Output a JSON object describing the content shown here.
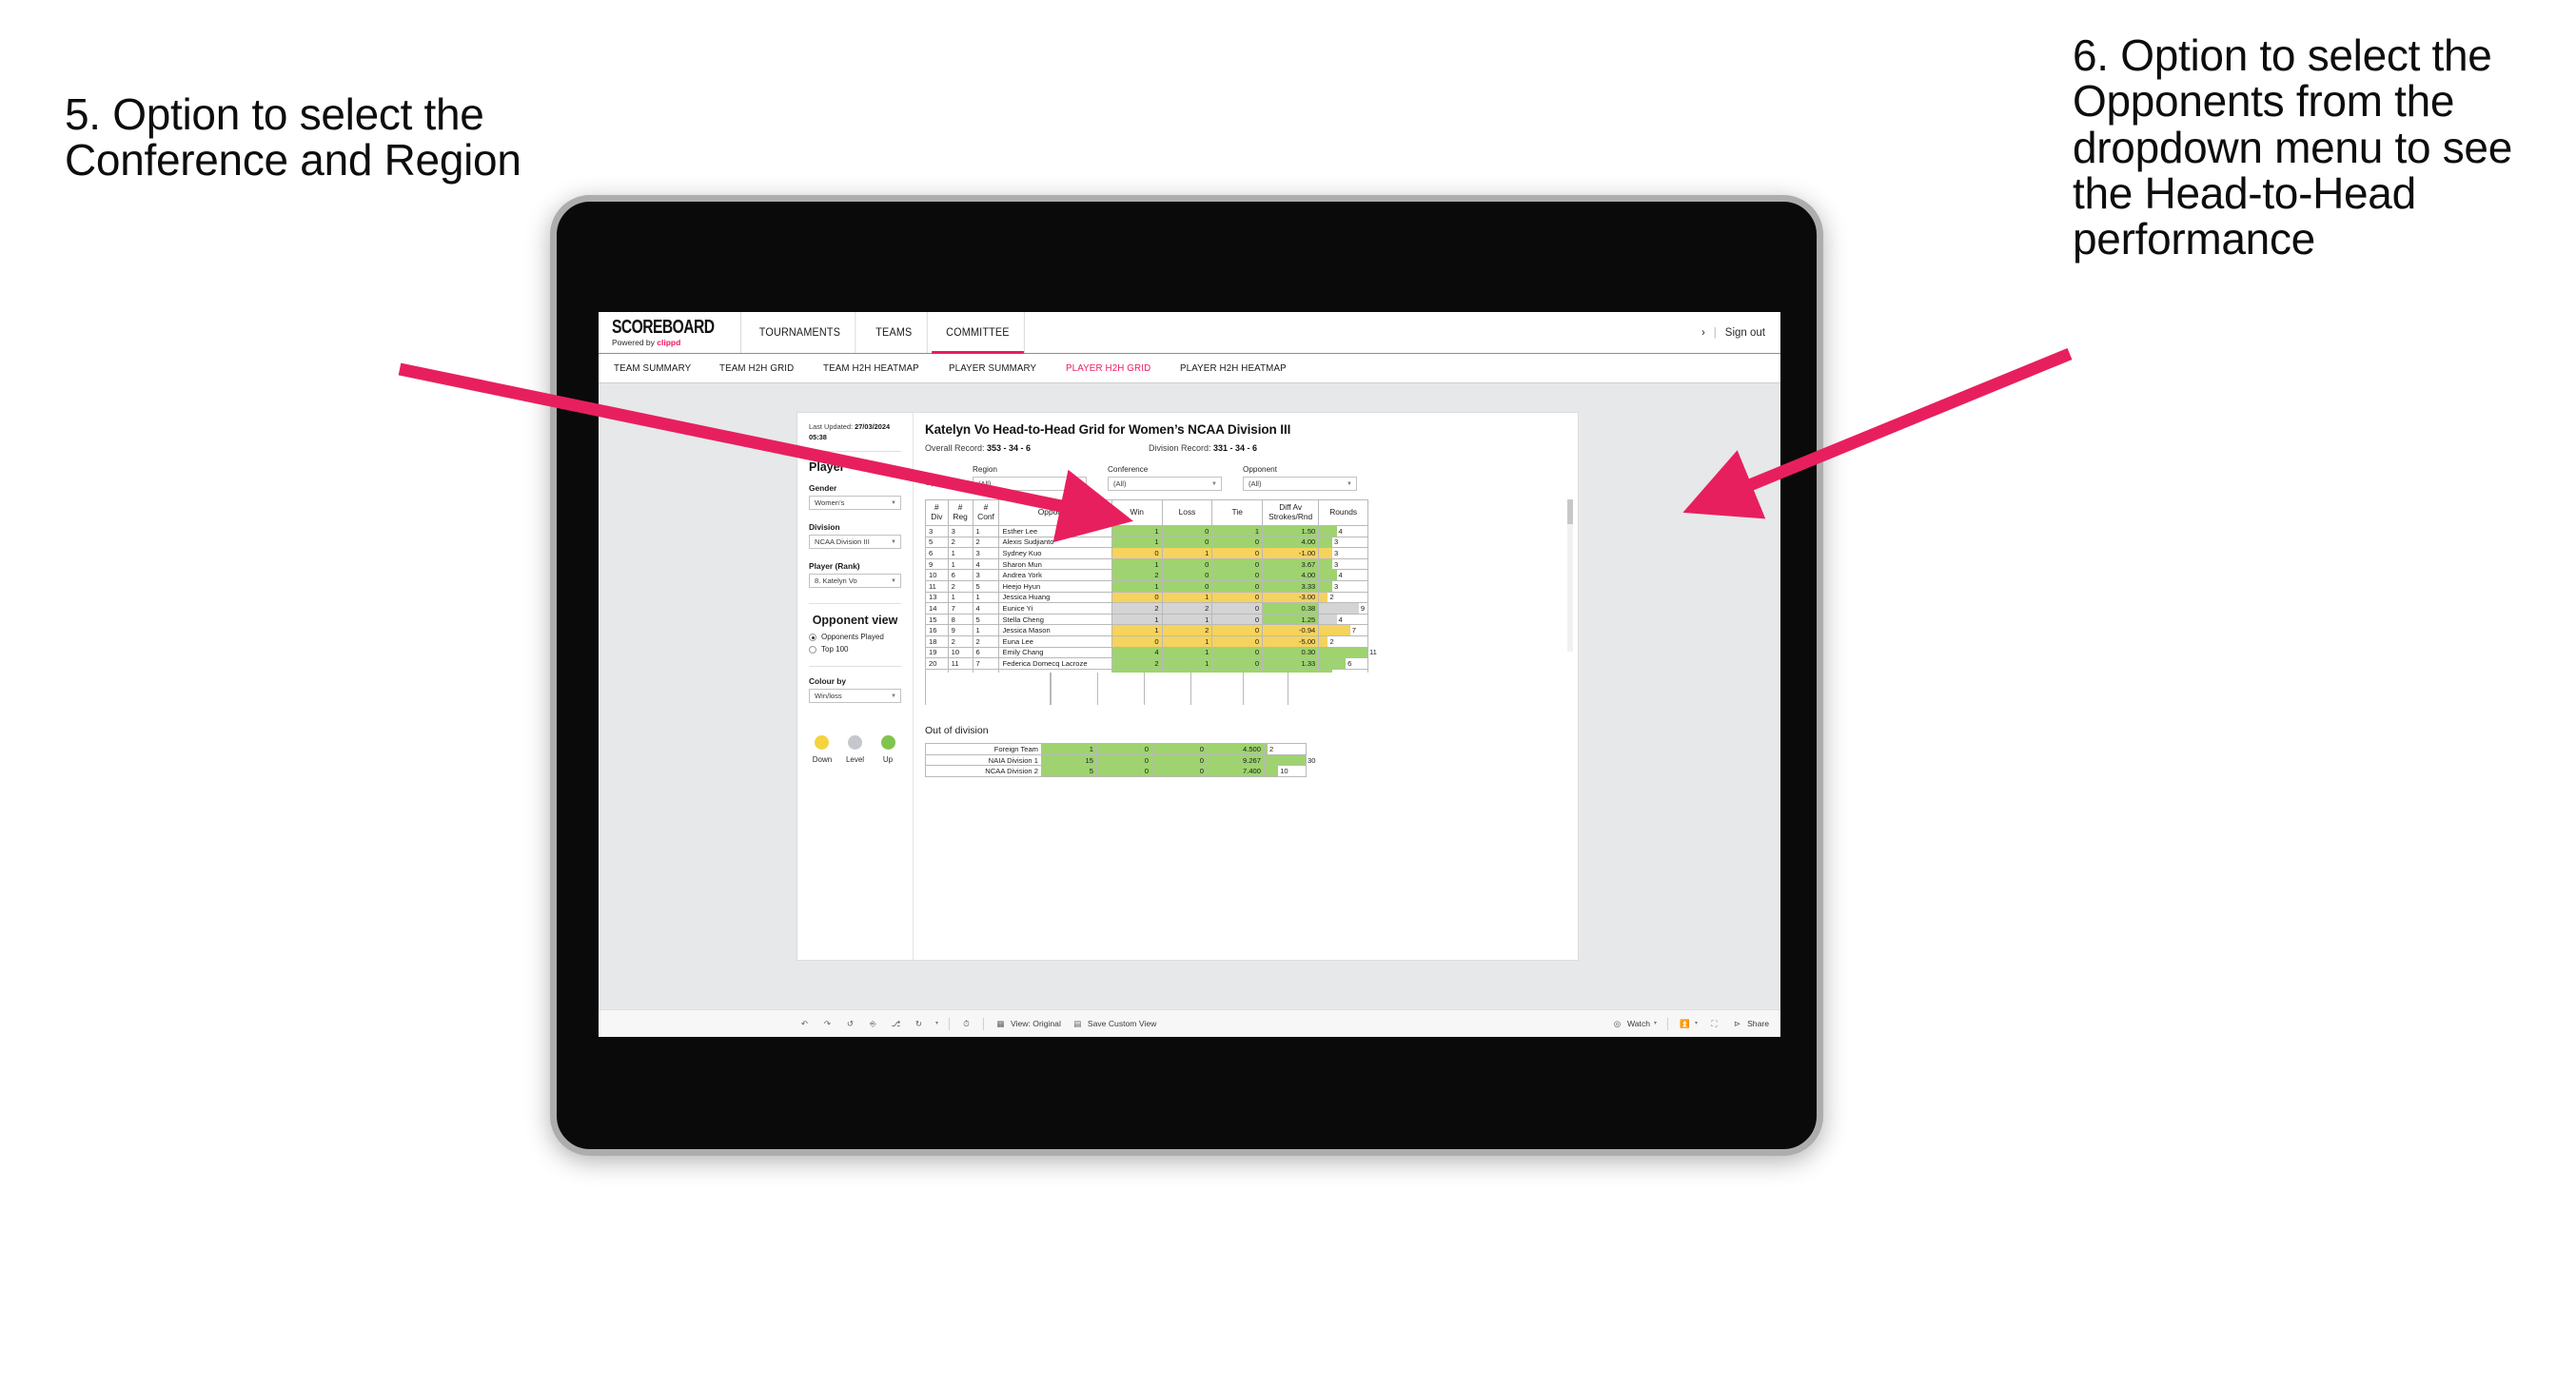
{
  "annotations": {
    "left": "5. Option to select the Conference and Region",
    "right": "6. Option to select the Opponents from the dropdown menu to see the Head-to-Head performance",
    "arrow_color": "#e81f5e"
  },
  "topnav": {
    "brand": "SCOREBOARD",
    "brand_sub_prefix": "Powered by ",
    "brand_sub_accent": "clippd",
    "items": [
      {
        "label": "TOURNAMENTS",
        "active": false
      },
      {
        "label": "TEAMS",
        "active": false
      },
      {
        "label": "COMMITTEE",
        "active": true
      }
    ],
    "chevron": "›",
    "separator": "|",
    "signout": "Sign out",
    "accent": "#ed1b5c"
  },
  "subnav": {
    "items": [
      {
        "label": "TEAM SUMMARY",
        "active": false
      },
      {
        "label": "TEAM H2H GRID",
        "active": false
      },
      {
        "label": "TEAM H2H HEATMAP",
        "active": false
      },
      {
        "label": "PLAYER SUMMARY",
        "active": false
      },
      {
        "label": "PLAYER H2H GRID",
        "active": true
      },
      {
        "label": "PLAYER H2H HEATMAP",
        "active": false
      }
    ]
  },
  "sidebar": {
    "last_updated_label": "Last Updated: ",
    "last_updated_value": "27/03/2024",
    "last_updated_time": "05:38",
    "player_heading": "Player",
    "fields": [
      {
        "label": "Gender",
        "value": "Women’s"
      },
      {
        "label": "Division",
        "value": "NCAA Division III"
      },
      {
        "label": "Player (Rank)",
        "value": "8. Katelyn Vo"
      }
    ],
    "opponent_view_heading": "Opponent view",
    "opponent_view_options": [
      {
        "label": "Opponents Played",
        "selected": true
      },
      {
        "label": "Top 100",
        "selected": false
      }
    ],
    "colour_by_label": "Colour by",
    "colour_by_value": "Win/loss",
    "legend": [
      {
        "label": "Down",
        "color": "#f5d340"
      },
      {
        "label": "Level",
        "color": "#c4c8cc"
      },
      {
        "label": "Up",
        "color": "#80c44d"
      }
    ]
  },
  "main": {
    "title": "Katelyn Vo Head-to-Head Grid for Women’s NCAA Division III",
    "overall_record_label": "Overall Record: ",
    "overall_record_value": "353 - 34 - 6",
    "division_record_label": "Division Record: ",
    "division_record_value": "331 - 34 - 6",
    "opponents_label": "Opponents:",
    "filters": [
      {
        "label": "Region",
        "value": "(All)"
      },
      {
        "label": "Conference",
        "value": "(All)"
      },
      {
        "label": "Opponent",
        "value": "(All)"
      }
    ]
  },
  "chart_data": {
    "type": "table",
    "title": "Katelyn Vo Head-to-Head Grid for Women’s NCAA Division III",
    "columns": [
      "# Div",
      "# Reg",
      "# Conf",
      "Opponent",
      "Win",
      "Loss",
      "Tie",
      "Diff Av Strokes/Rnd",
      "Rounds"
    ],
    "header_lines": [
      [
        "#",
        "Div"
      ],
      [
        "#",
        "Reg"
      ],
      [
        "#",
        "Conf"
      ],
      [
        "Opponent"
      ],
      [
        "Win"
      ],
      [
        "Loss"
      ],
      [
        "Tie"
      ],
      [
        "Diff Av",
        "Strokes/Rnd"
      ],
      [
        "Rounds"
      ]
    ],
    "rows": [
      {
        "div": "3",
        "reg": "3",
        "conf": "1",
        "opponent": "Esther Lee",
        "win": "1",
        "loss": "0",
        "tie": "1",
        "diff": "1.50",
        "rounds": "4",
        "color": "g",
        "bar_pct": 36
      },
      {
        "div": "5",
        "reg": "2",
        "conf": "2",
        "opponent": "Alexis Sudjianto",
        "win": "1",
        "loss": "0",
        "tie": "0",
        "diff": "4.00",
        "rounds": "3",
        "color": "g",
        "bar_pct": 27
      },
      {
        "div": "6",
        "reg": "1",
        "conf": "3",
        "opponent": "Sydney Kuo",
        "win": "0",
        "loss": "1",
        "tie": "0",
        "diff": "-1.00",
        "rounds": "3",
        "color": "y",
        "bar_pct": 27
      },
      {
        "div": "9",
        "reg": "1",
        "conf": "4",
        "opponent": "Sharon Mun",
        "win": "1",
        "loss": "0",
        "tie": "0",
        "diff": "3.67",
        "rounds": "3",
        "color": "g",
        "bar_pct": 27
      },
      {
        "div": "10",
        "reg": "6",
        "conf": "3",
        "opponent": "Andrea York",
        "win": "2",
        "loss": "0",
        "tie": "0",
        "diff": "4.00",
        "rounds": "4",
        "color": "g",
        "bar_pct": 36
      },
      {
        "div": "11",
        "reg": "2",
        "conf": "5",
        "opponent": "Heejo Hyun",
        "win": "1",
        "loss": "0",
        "tie": "0",
        "diff": "3.33",
        "rounds": "3",
        "color": "g",
        "bar_pct": 27
      },
      {
        "div": "13",
        "reg": "1",
        "conf": "1",
        "opponent": "Jessica Huang",
        "win": "0",
        "loss": "1",
        "tie": "0",
        "diff": "-3.00",
        "rounds": "2",
        "color": "y",
        "bar_pct": 18
      },
      {
        "div": "14",
        "reg": "7",
        "conf": "4",
        "opponent": "Eunice Yi",
        "win": "2",
        "loss": "2",
        "tie": "0",
        "diff": "0.38",
        "rounds": "9",
        "color": "n",
        "bar_pct": 82,
        "diff_color": "g"
      },
      {
        "div": "15",
        "reg": "8",
        "conf": "5",
        "opponent": "Stella Cheng",
        "win": "1",
        "loss": "1",
        "tie": "0",
        "diff": "1.25",
        "rounds": "4",
        "color": "n",
        "bar_pct": 36,
        "diff_color": "g"
      },
      {
        "div": "16",
        "reg": "9",
        "conf": "1",
        "opponent": "Jessica Mason",
        "win": "1",
        "loss": "2",
        "tie": "0",
        "diff": "-0.94",
        "rounds": "7",
        "color": "y",
        "bar_pct": 64
      },
      {
        "div": "18",
        "reg": "2",
        "conf": "2",
        "opponent": "Euna Lee",
        "win": "0",
        "loss": "1",
        "tie": "0",
        "diff": "-5.00",
        "rounds": "2",
        "color": "y",
        "bar_pct": 18
      },
      {
        "div": "19",
        "reg": "10",
        "conf": "6",
        "opponent": "Emily Chang",
        "win": "4",
        "loss": "1",
        "tie": "0",
        "diff": "0.30",
        "rounds": "11",
        "color": "g",
        "bar_pct": 100
      },
      {
        "div": "20",
        "reg": "11",
        "conf": "7",
        "opponent": "Federica Domecq Lacroze",
        "win": "2",
        "loss": "1",
        "tie": "0",
        "diff": "1.33",
        "rounds": "6",
        "color": "g",
        "bar_pct": 55
      }
    ],
    "out_of_division_title": "Out of division",
    "out_of_division_rows": [
      {
        "name": "Foreign Team",
        "win": "1",
        "loss": "0",
        "tie": "0",
        "diff": "4.500",
        "rounds": "2",
        "color": "g",
        "bar_pct": 7
      },
      {
        "name": "NAIA Division 1",
        "win": "15",
        "loss": "0",
        "tie": "0",
        "diff": "9.267",
        "rounds": "30",
        "color": "g",
        "bar_pct": 100
      },
      {
        "name": "NCAA Division 2",
        "win": "5",
        "loss": "0",
        "tie": "0",
        "diff": "7.400",
        "rounds": "10",
        "color": "g",
        "bar_pct": 33
      }
    ]
  },
  "toolbar": {
    "view_label": "View: Original",
    "save_label": "Save Custom View",
    "watch_label": "Watch",
    "share_label": "Share",
    "caret": "▾"
  }
}
